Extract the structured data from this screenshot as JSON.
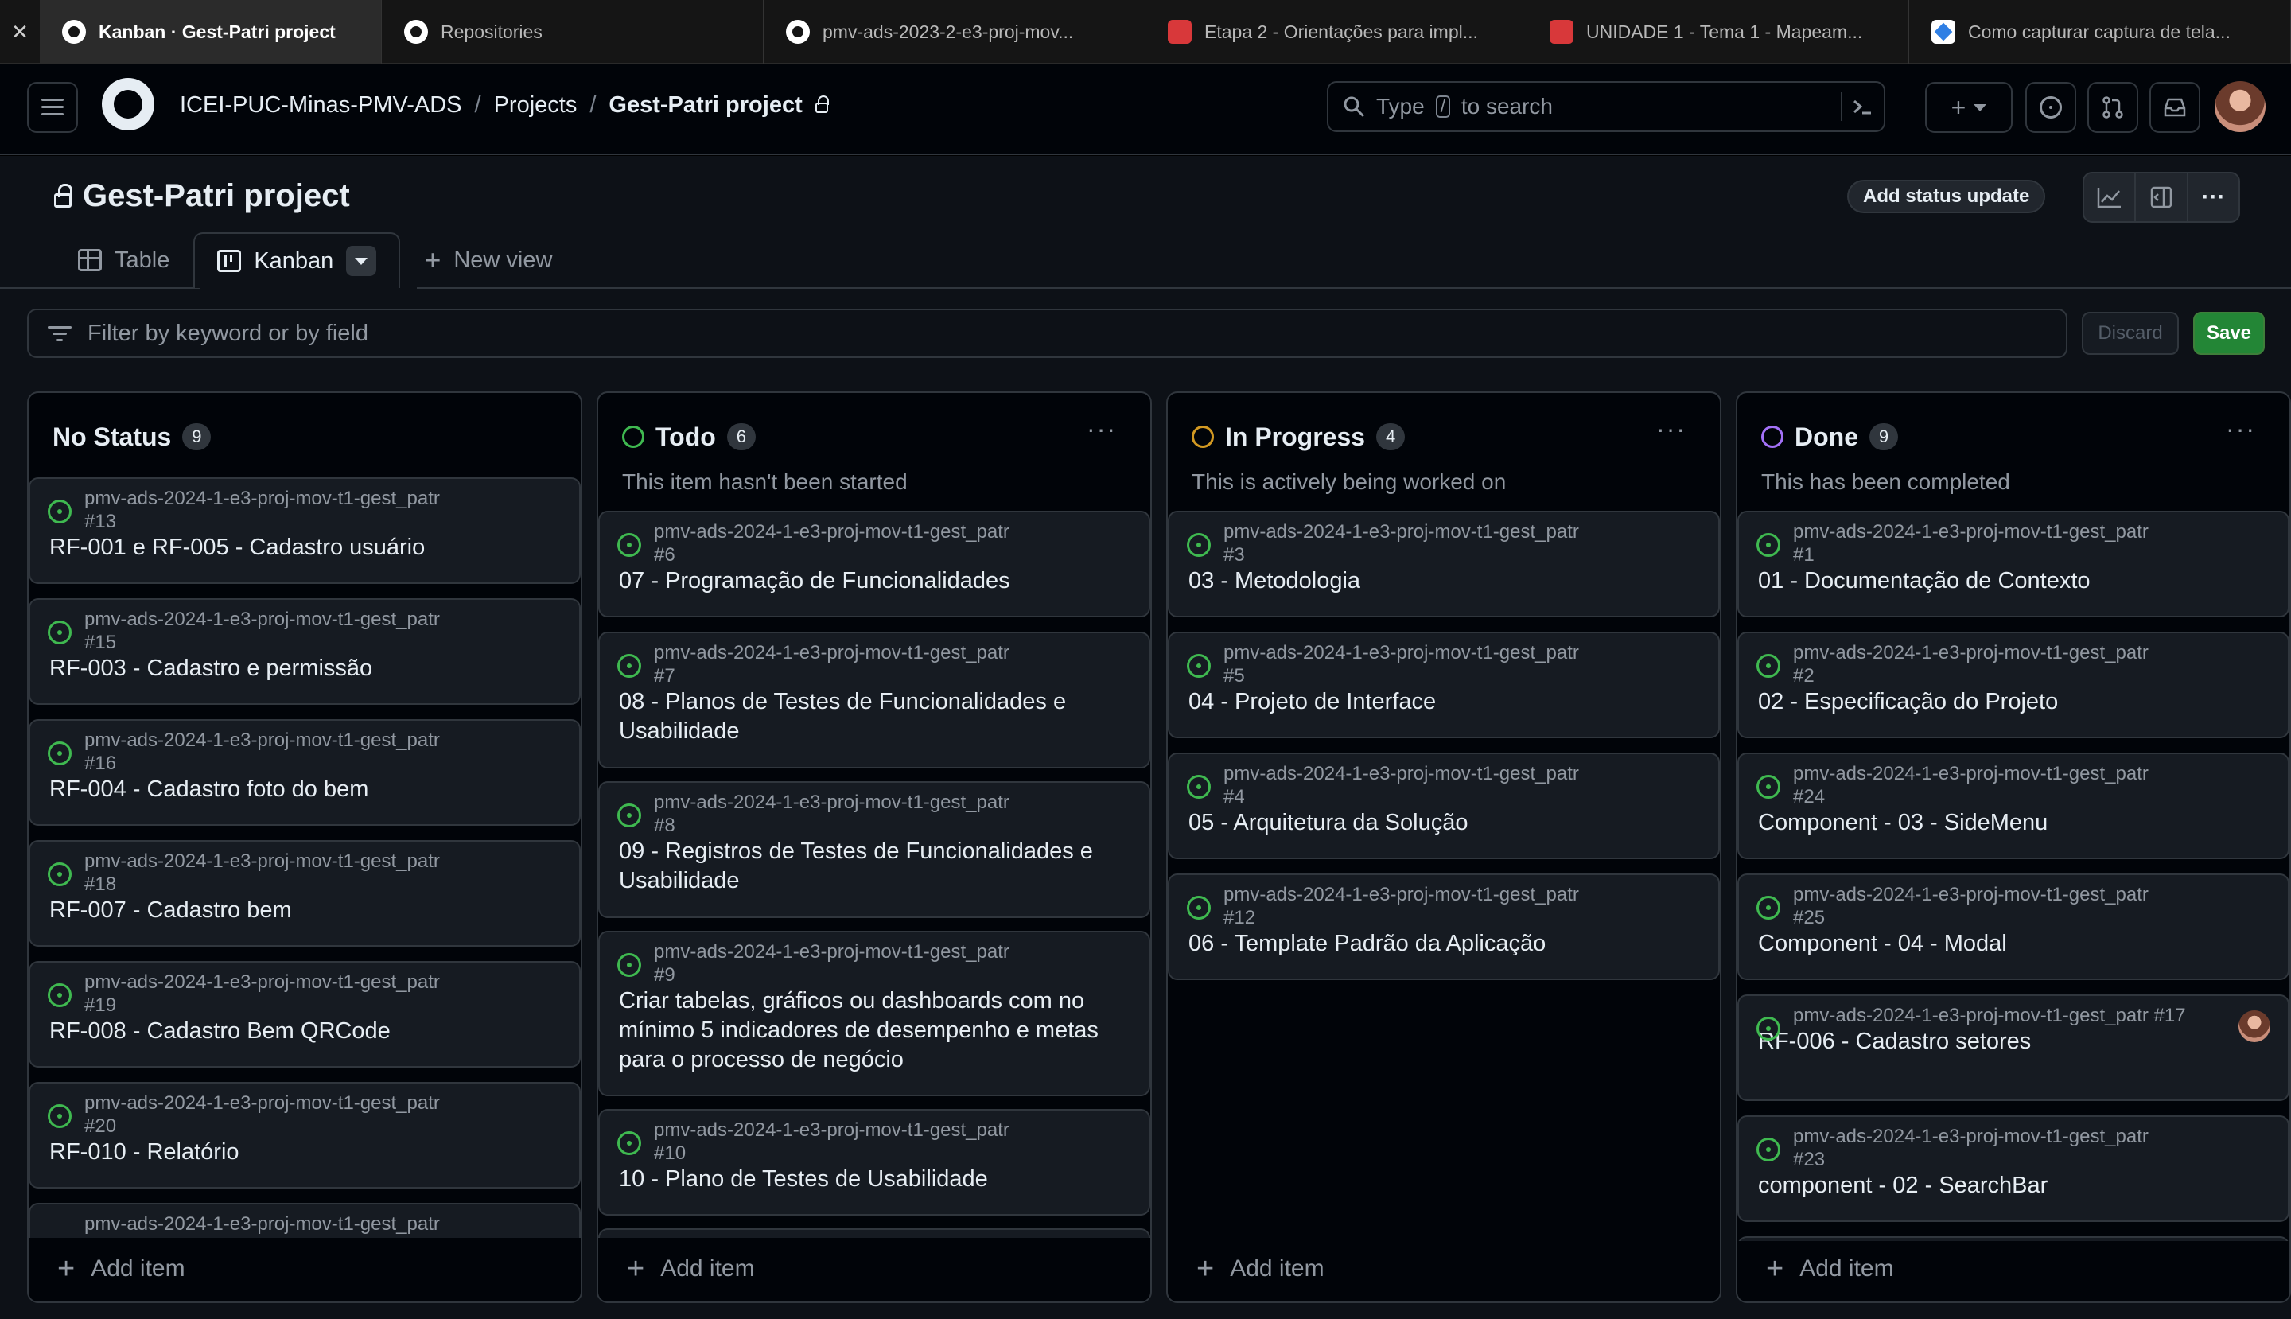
{
  "browser": {
    "close_glyph": "✕",
    "tabs": [
      {
        "label": "Kanban · Gest-Patri project",
        "favicon": "github-icon",
        "active": true
      },
      {
        "label": "Repositories",
        "favicon": "github-icon"
      },
      {
        "label": "pmv-ads-2023-2-e3-proj-mov...",
        "favicon": "github-icon"
      },
      {
        "label": "Etapa 2 - Orientações para impl...",
        "favicon": "puc-icon"
      },
      {
        "label": "UNIDADE 1 - Tema 1 - Mapeam...",
        "favicon": "puc-icon"
      },
      {
        "label": "Como capturar captura de tela...",
        "favicon": "doc-icon"
      }
    ]
  },
  "header": {
    "breadcrumb": {
      "org": "ICEI-PUC-Minas-PMV-ADS",
      "sep": "/",
      "section": "Projects",
      "project": "Gest-Patri project"
    },
    "search": {
      "prefix": "Type",
      "key": "/",
      "suffix": "to search"
    },
    "plus_glyph": "+"
  },
  "project": {
    "title": "Gest-Patri project",
    "status_update_label": "Add status update",
    "view_tabs": {
      "table": "Table",
      "kanban": "Kanban",
      "new_view": "New view"
    },
    "filter_placeholder": "Filter by keyword or by field",
    "discard_label": "Discard",
    "save_label": "Save",
    "add_item_label": "Add item",
    "menu_glyph": "···"
  },
  "colors": {
    "todo": "#3fb950",
    "in_progress": "#d29922",
    "done": "#a371f7",
    "save_button": "#238636"
  },
  "columns": [
    {
      "name": "No Status",
      "count": "9",
      "description": "",
      "cards": [
        {
          "repo": "pmv-ads-2024-1-e3-proj-mov-t1-gest_patr",
          "number": "#13",
          "title": "RF-001 e RF-005 - Cadastro usuário"
        },
        {
          "repo": "pmv-ads-2024-1-e3-proj-mov-t1-gest_patr",
          "number": "#15",
          "title": "RF-003 - Cadastro e permissão"
        },
        {
          "repo": "pmv-ads-2024-1-e3-proj-mov-t1-gest_patr",
          "number": "#16",
          "title": "RF-004 - Cadastro foto do bem"
        },
        {
          "repo": "pmv-ads-2024-1-e3-proj-mov-t1-gest_patr",
          "number": "#18",
          "title": "RF-007 - Cadastro bem"
        },
        {
          "repo": "pmv-ads-2024-1-e3-proj-mov-t1-gest_patr",
          "number": "#19",
          "title": "RF-008 - Cadastro Bem QRCode"
        },
        {
          "repo": "pmv-ads-2024-1-e3-proj-mov-t1-gest_patr",
          "number": "#20",
          "title": "RF-010 - Relatório"
        },
        {
          "repo": "pmv-ads-2024-1-e3-proj-mov-t1-gest_patr",
          "number": "",
          "title": ""
        }
      ]
    },
    {
      "name": "Todo",
      "count": "6",
      "description": "This item hasn't been started",
      "cards": [
        {
          "repo": "pmv-ads-2024-1-e3-proj-mov-t1-gest_patr",
          "number": "#6",
          "title": "07 - Programação de Funcionalidades"
        },
        {
          "repo": "pmv-ads-2024-1-e3-proj-mov-t1-gest_patr",
          "number": "#7",
          "title": "08 - Planos de Testes de Funcionalidades e Usabilidade"
        },
        {
          "repo": "pmv-ads-2024-1-e3-proj-mov-t1-gest_patr",
          "number": "#8",
          "title": "09 - Registros de Testes de Funcionalidades e Usabilidade"
        },
        {
          "repo": "pmv-ads-2024-1-e3-proj-mov-t1-gest_patr",
          "number": "#9",
          "title": "Criar tabelas, gráficos ou dashboards com no mínimo 5 indicadores de desempenho e metas para o processo de negócio"
        },
        {
          "repo": "pmv-ads-2024-1-e3-proj-mov-t1-gest_patr",
          "number": "#10",
          "title": "10 - Plano de Testes de Usabilidade"
        },
        {
          "repo": "",
          "number": "",
          "title": ""
        }
      ]
    },
    {
      "name": "In Progress",
      "count": "4",
      "description": "This is actively being worked on",
      "cards": [
        {
          "repo": "pmv-ads-2024-1-e3-proj-mov-t1-gest_patr",
          "number": "#3",
          "title": "03 - Metodologia"
        },
        {
          "repo": "pmv-ads-2024-1-e3-proj-mov-t1-gest_patr",
          "number": "#5",
          "title": "04 - Projeto de Interface"
        },
        {
          "repo": "pmv-ads-2024-1-e3-proj-mov-t1-gest_patr",
          "number": "#4",
          "title": "05 - Arquitetura da Solução"
        },
        {
          "repo": "pmv-ads-2024-1-e3-proj-mov-t1-gest_patr",
          "number": "#12",
          "title": "06 - Template Padrão da Aplicação"
        }
      ]
    },
    {
      "name": "Done",
      "count": "9",
      "description": "This has been completed",
      "cards": [
        {
          "repo": "pmv-ads-2024-1-e3-proj-mov-t1-gest_patr",
          "number": "#1",
          "title": "01 - Documentação de Contexto"
        },
        {
          "repo": "pmv-ads-2024-1-e3-proj-mov-t1-gest_patr",
          "number": "#2",
          "title": "02 - Especificação do Projeto"
        },
        {
          "repo": "pmv-ads-2024-1-e3-proj-mov-t1-gest_patr",
          "number": "#24",
          "title": "Component - 03 - SideMenu"
        },
        {
          "repo": "pmv-ads-2024-1-e3-proj-mov-t1-gest_patr",
          "number": "#25",
          "title": "Component - 04 - Modal"
        },
        {
          "repo": "pmv-ads-2024-1-e3-proj-mov-t1-gest_patr",
          "number": "#17",
          "title": "RF-006 - Cadastro setores",
          "assignee": true
        },
        {
          "repo": "pmv-ads-2024-1-e3-proj-mov-t1-gest_patr",
          "number": "#23",
          "title": "component - 02 - SearchBar"
        },
        {
          "repo": "",
          "number": "",
          "title": ""
        }
      ]
    }
  ]
}
